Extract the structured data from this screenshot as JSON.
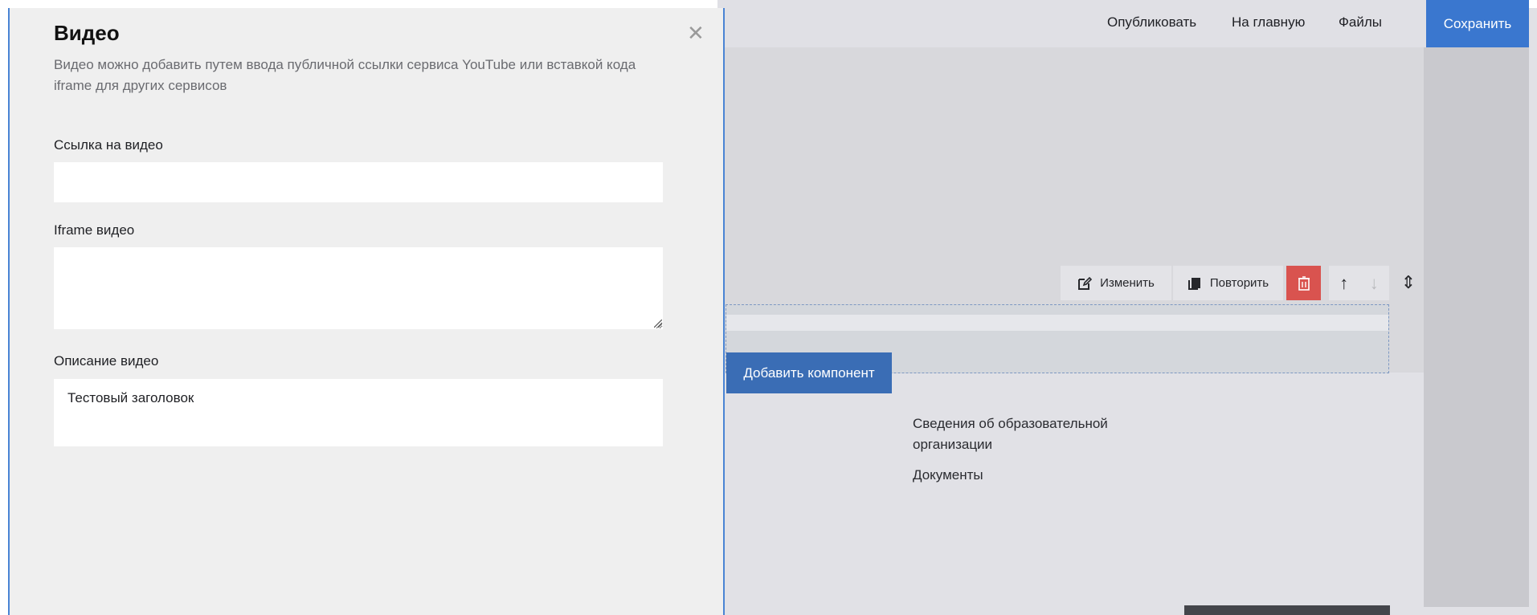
{
  "topbar": {
    "publish_label": "Опубликовать",
    "home_label": "На главную",
    "files_label": "Файлы",
    "save_label": "Сохранить"
  },
  "block_toolbar": {
    "edit_label": "Изменить",
    "repeat_label": "Повторить",
    "delete_icon": "trash-icon",
    "up_icon": "arrow-up-icon",
    "down_icon": "arrow-down-icon",
    "move_icon": "move-vertical-icon"
  },
  "add_component_label": "Добавить компонент",
  "page_menu": {
    "items": [
      "Сведения об образовательной организации",
      "Документы"
    ]
  },
  "modal": {
    "title": "Видео",
    "description": "Видео можно добавить путем ввода публичной ссылки сервиса YouTube или вставкой кода iframe для других сервисов",
    "fields": {
      "link_label": "Ссылка на видео",
      "link_value": "",
      "iframe_label": "Iframe видео",
      "iframe_value": "",
      "desc_label": "Описание видео",
      "desc_value": "Тестовый заголовок"
    },
    "close_icon": "close-icon"
  },
  "colors": {
    "accent": "#3a77cf",
    "danger": "#d9534f",
    "panel_border": "#4a84d4"
  }
}
